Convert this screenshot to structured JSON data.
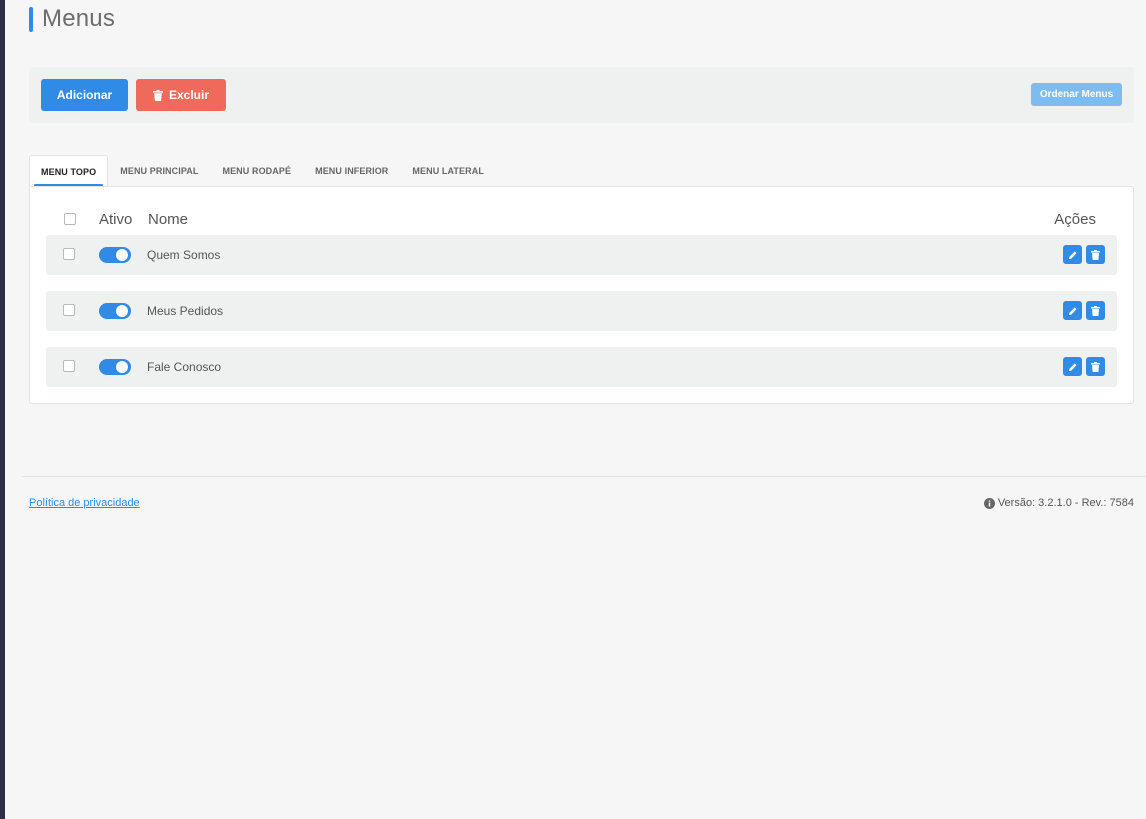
{
  "page": {
    "title": "Menus"
  },
  "toolbar": {
    "add_label": "Adicionar",
    "delete_label": "Excluir",
    "order_label": "Ordenar Menus"
  },
  "tabs": [
    {
      "label": "MENU TOPO",
      "active": true
    },
    {
      "label": "MENU PRINCIPAL",
      "active": false
    },
    {
      "label": "MENU RODAPÉ",
      "active": false
    },
    {
      "label": "MENU INFERIOR",
      "active": false
    },
    {
      "label": "MENU LATERAL",
      "active": false
    }
  ],
  "table": {
    "headers": {
      "active": "Ativo",
      "name": "Nome",
      "actions": "Ações"
    },
    "rows": [
      {
        "name": "Quem Somos",
        "active": true,
        "checked": false
      },
      {
        "name": "Meus Pedidos",
        "active": true,
        "checked": false
      },
      {
        "name": "Fale Conosco",
        "active": true,
        "checked": false
      }
    ]
  },
  "footer": {
    "privacy_label": "Política de privacidade",
    "version_text": "Versão: 3.2.1.0 - Rev.: 7584"
  },
  "colors": {
    "accent": "#2f8be6",
    "danger": "#ef6a5b",
    "order_button": "#7cbcf1",
    "sidebar_edge": "#2c2f4a"
  },
  "icons": {
    "delete_button": "trash-icon",
    "row_edit": "pencil-icon",
    "row_delete": "trash-icon",
    "version": "info-icon"
  }
}
